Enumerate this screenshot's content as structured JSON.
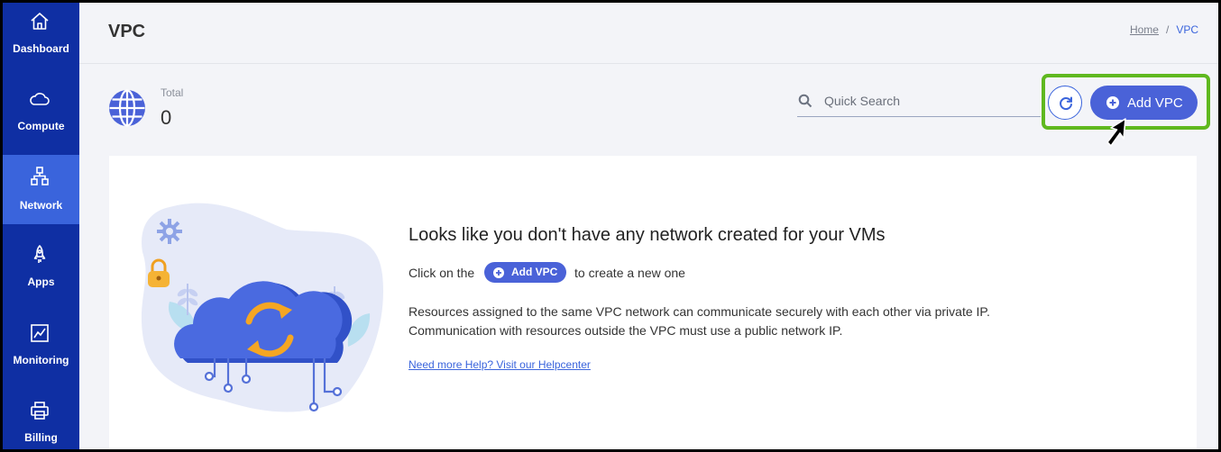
{
  "sidebar": {
    "items": [
      {
        "label": "Dashboard",
        "icon": "home-icon"
      },
      {
        "label": "Compute",
        "icon": "cloud-icon"
      },
      {
        "label": "Network",
        "icon": "network-icon",
        "active": true
      },
      {
        "label": "Apps",
        "icon": "rocket-icon"
      },
      {
        "label": "Monitoring",
        "icon": "chart-icon"
      },
      {
        "label": "Billing",
        "icon": "printer-icon"
      }
    ]
  },
  "header": {
    "title": "VPC",
    "breadcrumb": {
      "home": "Home",
      "separator": "/",
      "current": "VPC"
    }
  },
  "stats": {
    "total_label": "Total",
    "total_value": "0"
  },
  "search": {
    "placeholder": "Quick Search",
    "value": ""
  },
  "actions": {
    "add_label": "Add VPC"
  },
  "empty_state": {
    "title": "Looks like you don't have any network created for your VMs",
    "cta_prefix": "Click on the",
    "cta_button": "Add VPC",
    "cta_suffix": "to create a new one",
    "description_line1": "Resources assigned to the same VPC network can communicate securely with each other via private IP.",
    "description_line2": "Communication with resources outside the VPC must use a public network IP.",
    "help_link": "Need more Help? Visit our Helpcenter"
  },
  "colors": {
    "sidebar": "#0f2fa3",
    "sidebar_active": "#3a64dc",
    "primary": "#4a62d8",
    "highlight": "#5fb81f",
    "background": "#f3f4f8"
  }
}
